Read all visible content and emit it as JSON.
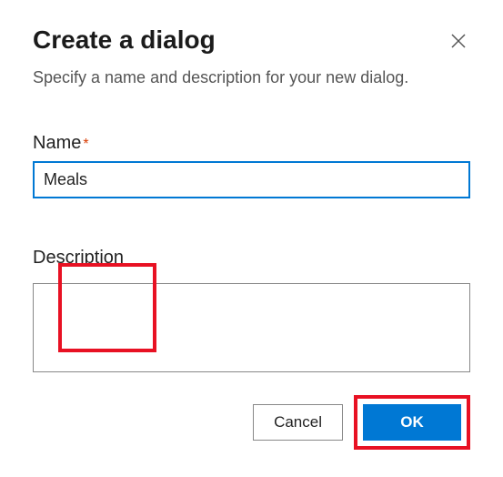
{
  "dialog": {
    "title": "Create a dialog",
    "subtitle": "Specify a name and description for your new dialog."
  },
  "fields": {
    "name": {
      "label": "Name",
      "required_mark": "*",
      "value": "Meals"
    },
    "description": {
      "label": "Description",
      "value": ""
    }
  },
  "buttons": {
    "cancel": "Cancel",
    "ok": "OK"
  }
}
